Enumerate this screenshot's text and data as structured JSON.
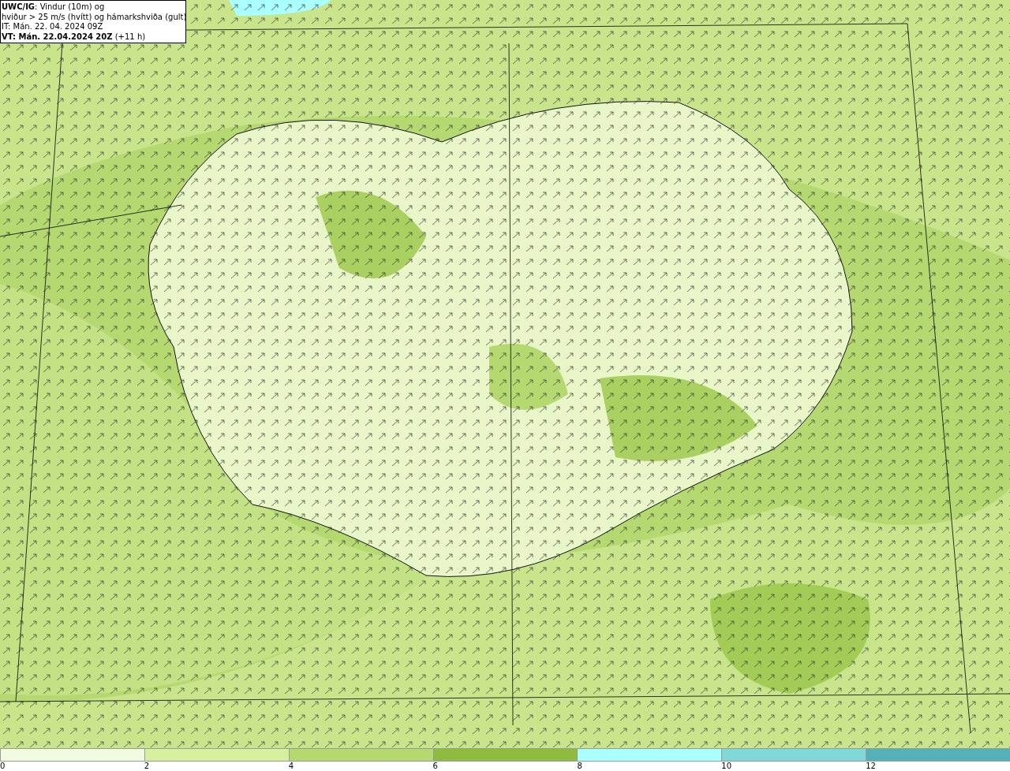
{
  "title_box": {
    "lines": [
      "**UWC/IG**: Vindur (10m) og",
      "hviður > 25 m/s (hvítt) og hámarkshviða (gult)",
      "IT: Mán. 22. 04. 2024 09Z",
      "**VT: Mán. 22.04.2024 20Z** (+11 h)"
    ]
  },
  "legend": {
    "bins": [
      {
        "color": "#f2fadf",
        "label": "0"
      },
      {
        "color": "#d6f0a0",
        "label": "2"
      },
      {
        "color": "#b5d970",
        "label": "4"
      },
      {
        "color": "#8fbb40",
        "label": "6"
      },
      {
        "color": "#aaffff",
        "label": "8"
      },
      {
        "color": "#80d8d8",
        "label": "10"
      },
      {
        "color": "#55b0b8",
        "label": "12"
      }
    ]
  }
}
